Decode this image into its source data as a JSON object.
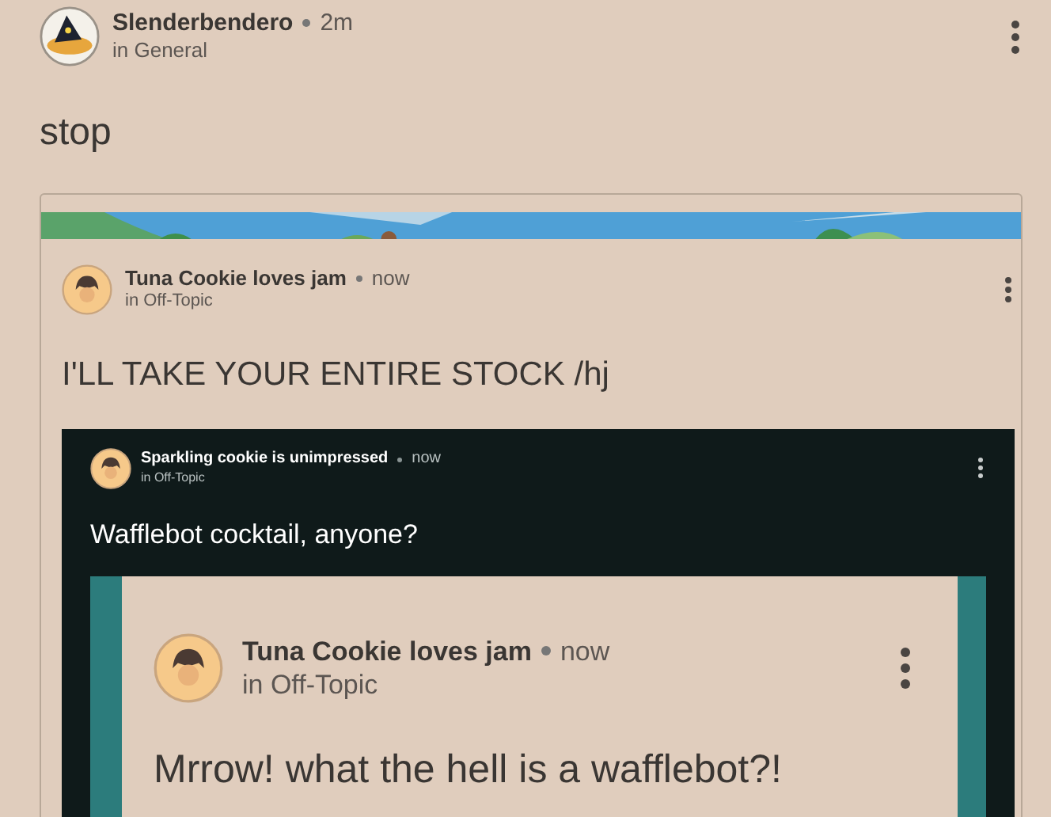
{
  "post": {
    "author": "Slenderbendero",
    "time": "2m",
    "channel": "in General",
    "text": "stop",
    "quote": {
      "kind": "card",
      "post": {
        "author": "Tuna Cookie loves jam",
        "time": "now",
        "channel": "in Off-Topic",
        "text": "I'LL TAKE YOUR ENTIRE STOCK /hj",
        "quote": {
          "kind": "dark",
          "post": {
            "author": "Sparkling cookie is unimpressed",
            "time": "now",
            "channel": "in Off-Topic",
            "text": "Wafflebot cocktail, anyone?",
            "quote": {
              "kind": "framed",
              "post": {
                "author": "Tuna Cookie loves jam",
                "time": "now",
                "channel": "in Off-Topic",
                "text": "Mrrow! what the hell is a wafflebot?!"
              }
            }
          }
        }
      }
    }
  }
}
